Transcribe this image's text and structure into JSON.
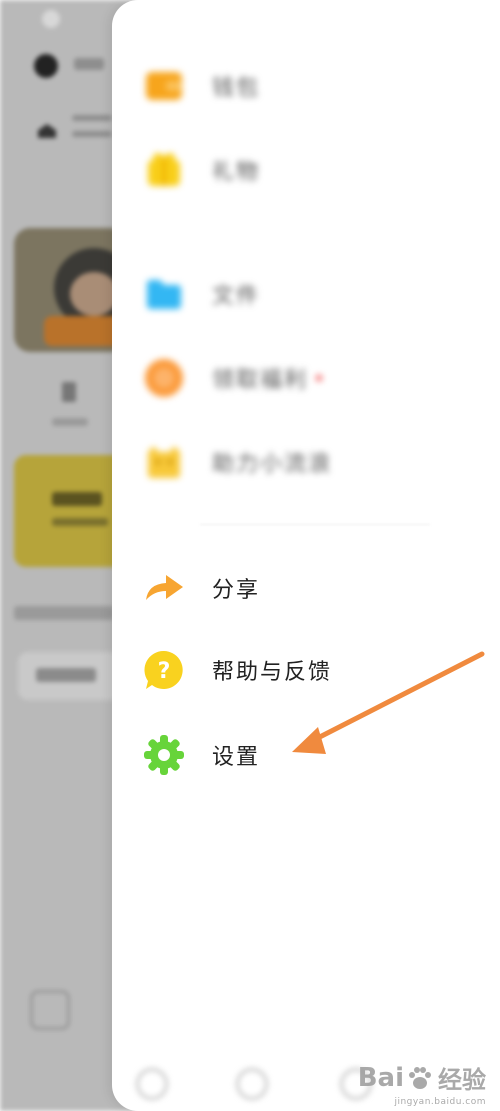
{
  "drawer": {
    "items": [
      {
        "label": "钱包",
        "icon": "wallet-icon",
        "color": "#f7a51c",
        "blurred": true
      },
      {
        "label": "礼物",
        "icon": "gift-icon",
        "color": "#f9cf1a",
        "blurred": true
      },
      {
        "label": "文件",
        "icon": "folder-icon",
        "color": "#33b7f3",
        "blurred": true
      },
      {
        "label": "领取福利",
        "icon": "benefit-icon",
        "color": "#fb9a3a",
        "blurred": true,
        "has_badge": true
      },
      {
        "label": "助力小流浪",
        "icon": "cat-icon",
        "color": "#f8c93a",
        "blurred": true
      },
      {
        "label": "分享",
        "icon": "share-arrow-icon",
        "color": "#f7a531",
        "blurred": false
      },
      {
        "label": "帮助与反馈",
        "icon": "help-question-icon",
        "color": "#f9d21f",
        "blurred": false
      },
      {
        "label": "设置",
        "icon": "settings-gear-icon",
        "color": "#67d43a",
        "blurred": false
      }
    ]
  },
  "annotation": {
    "arrow_color": "#f08a3e"
  },
  "watermark": {
    "brand_left": "Bai",
    "brand_right": "经验",
    "url": "jingyan.baidu.com"
  },
  "colors": {
    "drawer_background": "#ffffff",
    "dim_overlay": "#b9b9b9"
  }
}
